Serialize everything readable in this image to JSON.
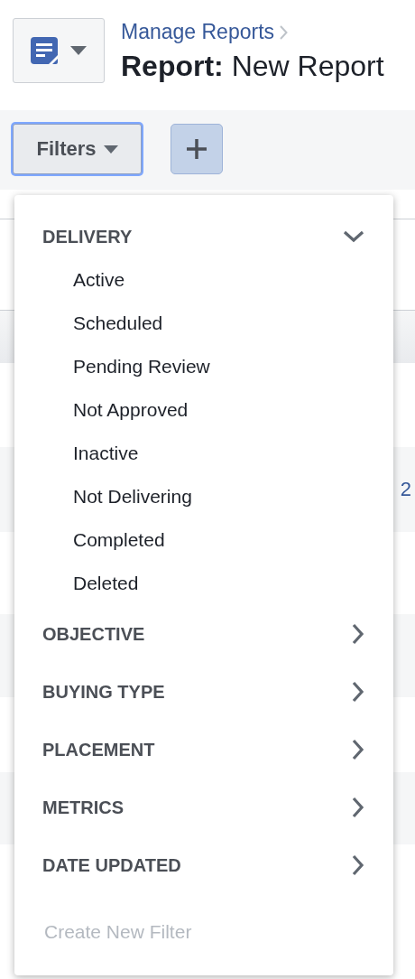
{
  "header": {
    "breadcrumb": "Manage Reports",
    "title": "**Report:** New Report"
  },
  "toolbar": {
    "filters_button": {
      "label": "Filters",
      "expanded": true
    }
  },
  "background": {
    "fragment": "2"
  },
  "filter_menu": {
    "sections": [
      {
        "label": "DELIVERY",
        "expanded": true,
        "items": [
          "Active",
          "Scheduled",
          "Pending Review",
          "Not Approved",
          "Inactive",
          "Not Delivering",
          "Completed",
          "Deleted"
        ]
      },
      {
        "label": "OBJECTIVE",
        "expanded": false
      },
      {
        "label": "BUYING TYPE",
        "expanded": false
      },
      {
        "label": "PLACEMENT",
        "expanded": false
      },
      {
        "label": "METRICS",
        "expanded": false
      },
      {
        "label": "DATE UPDATED",
        "expanded": false
      }
    ],
    "create": {
      "label": "Create New Filter",
      "disabled": true
    }
  }
}
